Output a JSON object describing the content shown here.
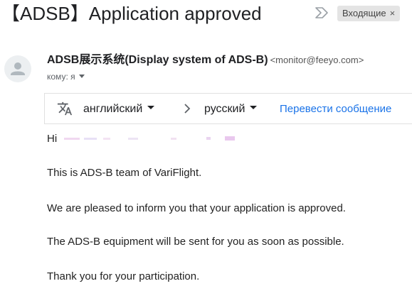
{
  "subject": {
    "title": "【ADSB】Application approved",
    "label_chip": "Входящие",
    "label_close": "×"
  },
  "icons": {
    "importance": "importance-marker-icon",
    "avatar": "person-icon",
    "translate": "translate-icon",
    "arrow": "chevron-right-icon",
    "dropdown": "caret-down-icon"
  },
  "sender": {
    "name": "ADSB展示系统(Display system of ADS-B)",
    "email": "<monitor@feeyo.com>",
    "to_label": "кому: я"
  },
  "translate_bar": {
    "from_lang": "английский",
    "to_lang": "русский",
    "translate_link": "Перевести сообщение"
  },
  "body": {
    "greeting": "Hi",
    "line1": "This is ADS-B team of VariFlight.",
    "line2": "We are pleased to inform you that your application is approved.",
    "line3": "The ADS-B equipment will be sent for you as soon as possible.",
    "line4": "Thank you for your participation."
  },
  "colors": {
    "link": "#1a73e8",
    "chip_bg": "#e4e4e4",
    "text": "#222222",
    "muted": "#5f6368"
  }
}
